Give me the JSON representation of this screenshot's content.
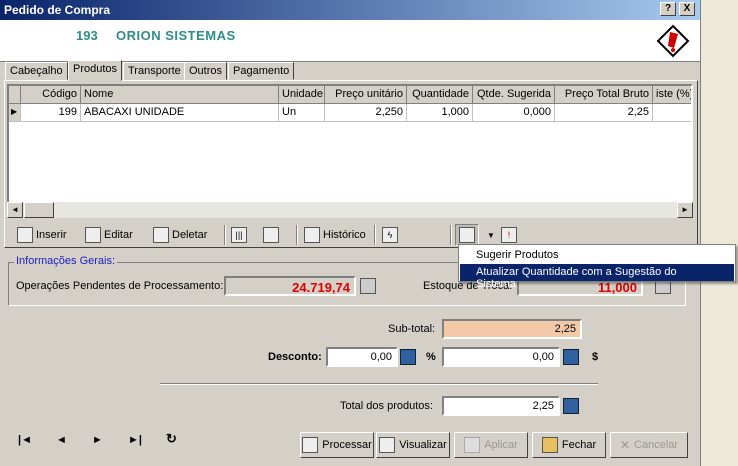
{
  "window": {
    "title": "Pedido de Compra",
    "help": "?",
    "close": "X"
  },
  "header": {
    "number": "193",
    "company": "ORION SISTEMAS"
  },
  "tabs": [
    {
      "label": "Cabeçalho"
    },
    {
      "label": "Produtos"
    },
    {
      "label": "Transporte"
    },
    {
      "label": "Outros"
    },
    {
      "label": "Pagamento"
    }
  ],
  "grid": {
    "columns": [
      "Código",
      "Nome",
      "Unidade",
      "Preço unitário",
      "Quantidade",
      "Qtde. Sugerida",
      "Preço Total Bruto",
      "iste (%)"
    ],
    "rows": [
      {
        "codigo": "199",
        "nome": "ABACAXI UNIDADE",
        "unidade": "Un",
        "preco": "2,250",
        "quantidade": "1,000",
        "sugerida": "0,000",
        "total": "2,25"
      }
    ]
  },
  "toolbar": {
    "inserir": "Inserir",
    "editar": "Editar",
    "deletar": "Deletar",
    "historico": "Histórico"
  },
  "menu": {
    "items": [
      {
        "label": "Sugerir Produtos"
      },
      {
        "label": "Atualizar Quantidade com a Sugestão do Sistema"
      }
    ]
  },
  "info": {
    "title": "Informações Gerais:",
    "pendentes_label": "Operações Pendentes de Processamento:",
    "pendentes_value": "24.719,74",
    "estoque_label": "Estoque de Troca:",
    "estoque_value": "11,000"
  },
  "totals": {
    "subtotal_label": "Sub-total:",
    "subtotal_value": "2,25",
    "desconto_label": "Desconto:",
    "desconto_value": "0,00",
    "percent": "%",
    "desconto_money": "0,00",
    "currency": "$",
    "total_label": "Total dos produtos:",
    "total_value": "2,25"
  },
  "nav": {
    "first": "|◄",
    "prev": "◄",
    "next": "►",
    "last": "►|",
    "refresh": "↻"
  },
  "buttons": {
    "processar": "Processar",
    "visualizar": "Visualizar",
    "aplicar": "Aplicar",
    "fechar": "Fechar",
    "cancelar": "Cancelar"
  }
}
